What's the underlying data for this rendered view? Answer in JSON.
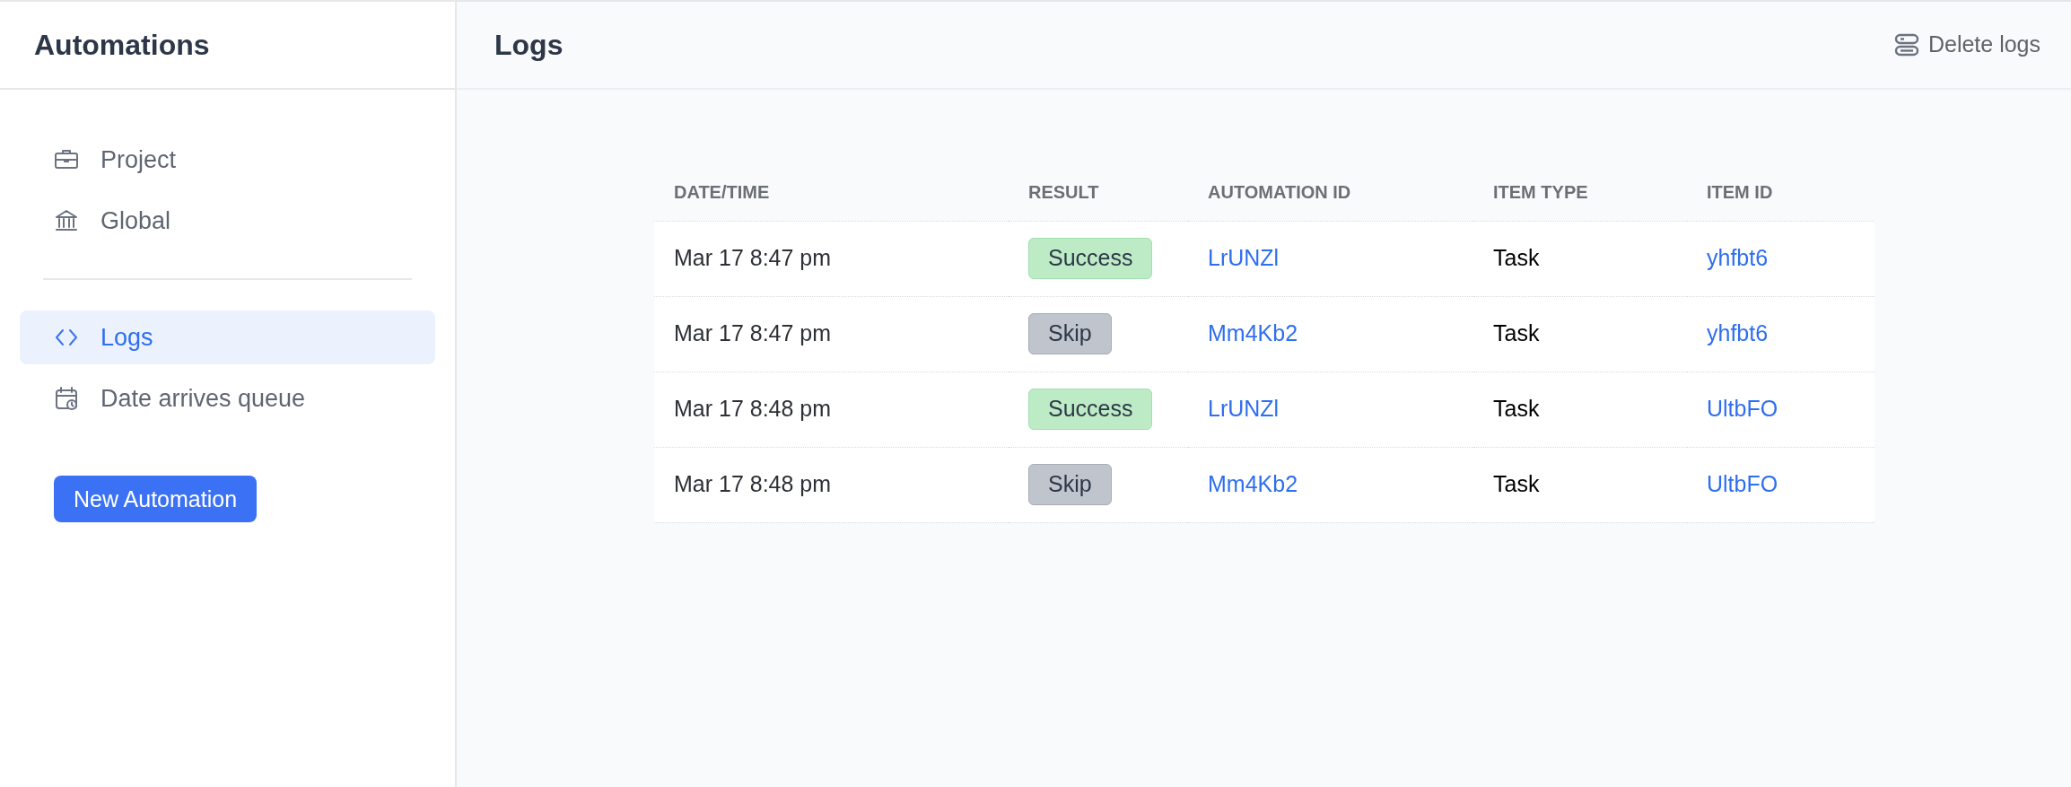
{
  "sidebar": {
    "title": "Automations",
    "groups": [
      [
        {
          "label": "Project",
          "selected": false
        },
        {
          "label": "Global",
          "selected": false
        }
      ],
      [
        {
          "label": "Logs",
          "selected": true
        },
        {
          "label": "Date arrives queue",
          "selected": false
        }
      ]
    ],
    "button": "New Automation"
  },
  "header": {
    "title": "Logs",
    "action": "Delete logs"
  },
  "table": {
    "columns": [
      "DATE/TIME",
      "RESULT",
      "AUTOMATION ID",
      "ITEM TYPE",
      "ITEM ID"
    ],
    "rows": [
      {
        "datetime": "Mar 17 8:47 pm",
        "result": {
          "label": "Success",
          "kind": "success"
        },
        "automation_id": "LrUNZl",
        "item_type": "Task",
        "item_id": "yhfbt6"
      },
      {
        "datetime": "Mar 17 8:47 pm",
        "result": {
          "label": "Skip",
          "kind": "skip"
        },
        "automation_id": "Mm4Kb2",
        "item_type": "Task",
        "item_id": "yhfbt6"
      },
      {
        "datetime": "Mar 17 8:48 pm",
        "result": {
          "label": "Success",
          "kind": "success"
        },
        "automation_id": "LrUNZl",
        "item_type": "Task",
        "item_id": "UltbFO"
      },
      {
        "datetime": "Mar 17 8:48 pm",
        "result": {
          "label": "Skip",
          "kind": "skip"
        },
        "automation_id": "Mm4Kb2",
        "item_type": "Task",
        "item_id": "UltbFO"
      }
    ]
  }
}
